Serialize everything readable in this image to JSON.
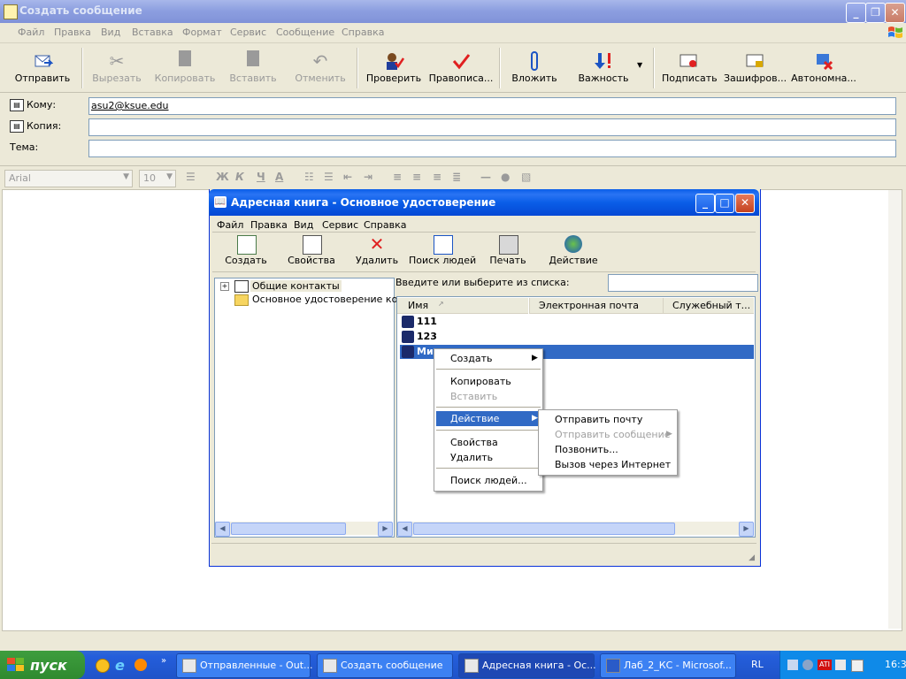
{
  "main_window": {
    "title": "Создать сообщение",
    "menu": [
      "Файл",
      "Правка",
      "Вид",
      "Вставка",
      "Формат",
      "Сервис",
      "Сообщение",
      "Справка"
    ],
    "toolbar": [
      {
        "label": "Отправить",
        "icon": "send-icon",
        "enabled": true
      },
      {
        "label": "Вырезать",
        "icon": "scissors-icon",
        "enabled": false
      },
      {
        "label": "Копировать",
        "icon": "copy-icon",
        "enabled": false
      },
      {
        "label": "Вставить",
        "icon": "paste-icon",
        "enabled": false
      },
      {
        "label": "Отменить",
        "icon": "undo-icon",
        "enabled": false
      },
      {
        "label": "Проверить",
        "icon": "check-names-icon",
        "enabled": true
      },
      {
        "label": "Правописа...",
        "icon": "spelling-icon",
        "enabled": true
      },
      {
        "label": "Вложить",
        "icon": "paperclip-icon",
        "enabled": true
      },
      {
        "label": "Важность",
        "icon": "priority-icon",
        "enabled": true
      },
      {
        "label": "Подписать",
        "icon": "sign-icon",
        "enabled": true
      },
      {
        "label": "Зашифров...",
        "icon": "encrypt-icon",
        "enabled": true
      },
      {
        "label": "Автономна...",
        "icon": "offline-icon",
        "enabled": true
      }
    ],
    "header": {
      "to_label": "Кому:",
      "to_value": "asu2@ksue.edu",
      "cc_label": "Копия:",
      "cc_value": "",
      "subject_label": "Тема:",
      "subject_value": ""
    },
    "format_bar": {
      "font": "Arial",
      "size": "10",
      "bold": "Ж",
      "italic": "К",
      "underline": "Ч",
      "font_color": "A"
    }
  },
  "address_book": {
    "title": "Адресная книга - Основное удостоверение",
    "menu": [
      "Файл",
      "Правка",
      "Вид",
      "Сервис",
      "Справка"
    ],
    "toolbar": [
      {
        "label": "Создать",
        "icon": "new-contact-icon"
      },
      {
        "label": "Свойства",
        "icon": "properties-icon"
      },
      {
        "label": "Удалить",
        "icon": "delete-icon"
      },
      {
        "label": "Поиск людей",
        "icon": "find-people-icon"
      },
      {
        "label": "Печать",
        "icon": "print-icon"
      },
      {
        "label": "Действие",
        "icon": "action-icon"
      }
    ],
    "tree": {
      "root": "Общие контакты",
      "child": "Основное удостоверение конт"
    },
    "search_label": "Введите или выберите из списка:",
    "search_value": "",
    "columns": [
      "Имя",
      "Электронная почта",
      "Служебный т..."
    ],
    "contacts": [
      "111",
      "123",
      "Ми"
    ]
  },
  "context_menu": {
    "items": [
      {
        "label": "Создать",
        "submenu": true,
        "enabled": true
      },
      {
        "label": "Копировать",
        "submenu": false,
        "enabled": true
      },
      {
        "label": "Вставить",
        "submenu": false,
        "enabled": false
      },
      {
        "label": "Действие",
        "submenu": true,
        "enabled": true,
        "highlighted": true
      },
      {
        "label": "Свойства",
        "submenu": false,
        "enabled": true
      },
      {
        "label": "Удалить",
        "submenu": false,
        "enabled": true
      },
      {
        "label": "Поиск людей...",
        "submenu": false,
        "enabled": true
      }
    ]
  },
  "action_submenu": {
    "items": [
      {
        "label": "Отправить почту",
        "enabled": true
      },
      {
        "label": "Отправить сообщение",
        "enabled": false,
        "submenu": true
      },
      {
        "label": "Позвонить...",
        "enabled": true
      },
      {
        "label": "Вызов через Интернет",
        "enabled": true
      }
    ]
  },
  "taskbar": {
    "start": "пуск",
    "tasks": [
      {
        "label": "Отправленные - Out...",
        "active": false
      },
      {
        "label": "Создать сообщение",
        "active": false
      },
      {
        "label": "Адресная книга - Ос...",
        "active": true
      },
      {
        "label": "Лаб_2_КС - Microsof...",
        "active": false
      }
    ],
    "language": "RL",
    "clock": "16:3"
  },
  "colors": {
    "xp_blue": "#0a5ee8",
    "highlight": "#316ac5",
    "start_green": "#2f8a2f"
  }
}
